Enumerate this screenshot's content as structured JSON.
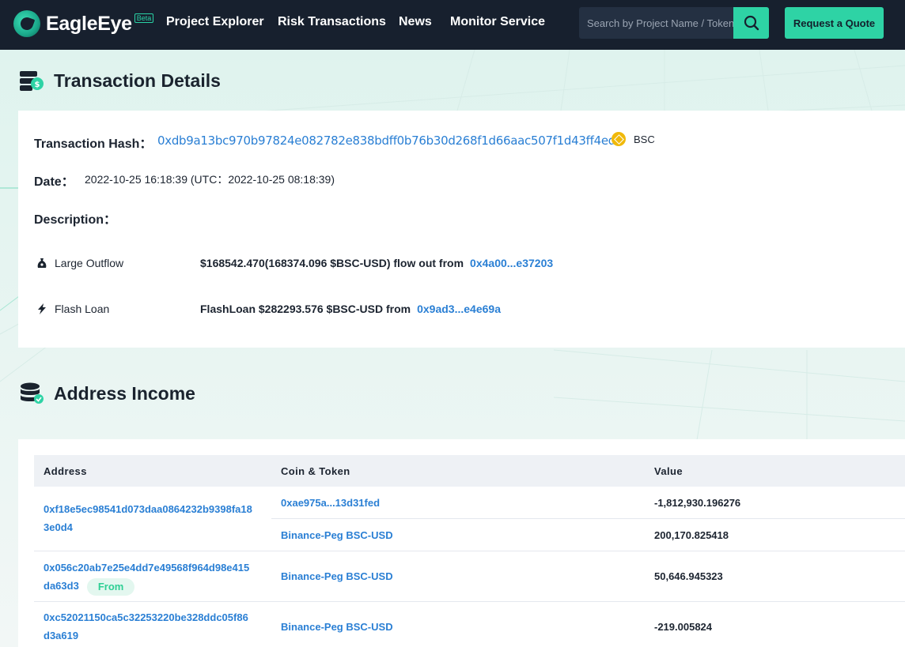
{
  "nav": {
    "brand": "EagleEye",
    "beta": "Beta",
    "links": [
      "Project Explorer",
      "Risk Transactions",
      "News",
      "Monitor Service"
    ],
    "search_placeholder": "Search by Project Name / Token",
    "quote_button": "Request a Quote"
  },
  "details": {
    "section_title": "Transaction Details",
    "hash_label": "Transaction Hash：",
    "hash_value": "0xdb9a13bc970b97824e082782e838bdff0b76b30d268f1d66aac507f1d43ff4ed",
    "chain": "BSC",
    "date_label": "Date：",
    "date_value": "2022-10-25 16:18:39 (UTC：2022-10-25 08:18:39)",
    "description_label": "Description：",
    "descriptions": [
      {
        "icon": "money-bag-icon",
        "type": "Large Outflow",
        "text": "$168542.470(168374.096 $BSC-USD) flow out from",
        "address": "0x4a00...e37203"
      },
      {
        "icon": "lightning-icon",
        "type": "Flash Loan",
        "text": "FlashLoan $282293.576 $BSC-USD from",
        "address": "0x9ad3...e4e69a"
      }
    ]
  },
  "income": {
    "section_title": "Address Income",
    "columns": [
      "Address",
      "Coin & Token",
      "Value"
    ],
    "rows": [
      {
        "address": "0xf18e5ec98541d073daa0864232b9398fa183e0d4",
        "badge": "",
        "entries": [
          {
            "coin": "0xae975a...13d31fed",
            "value": "-1,812,930.196276"
          },
          {
            "coin": "Binance-Peg BSC-USD",
            "value": "200,170.825418"
          }
        ]
      },
      {
        "address": "0x056c20ab7e25e4dd7e49568f964d98e415da63d3",
        "badge": "From",
        "entries": [
          {
            "coin": "Binance-Peg BSC-USD",
            "value": "50,646.945323"
          }
        ]
      },
      {
        "address": "0xc52021150ca5c32253220be328ddc05f86d3a619",
        "badge": "",
        "entries": [
          {
            "coin": "Binance-Peg BSC-USD",
            "value": "-219.005824"
          }
        ]
      }
    ]
  }
}
